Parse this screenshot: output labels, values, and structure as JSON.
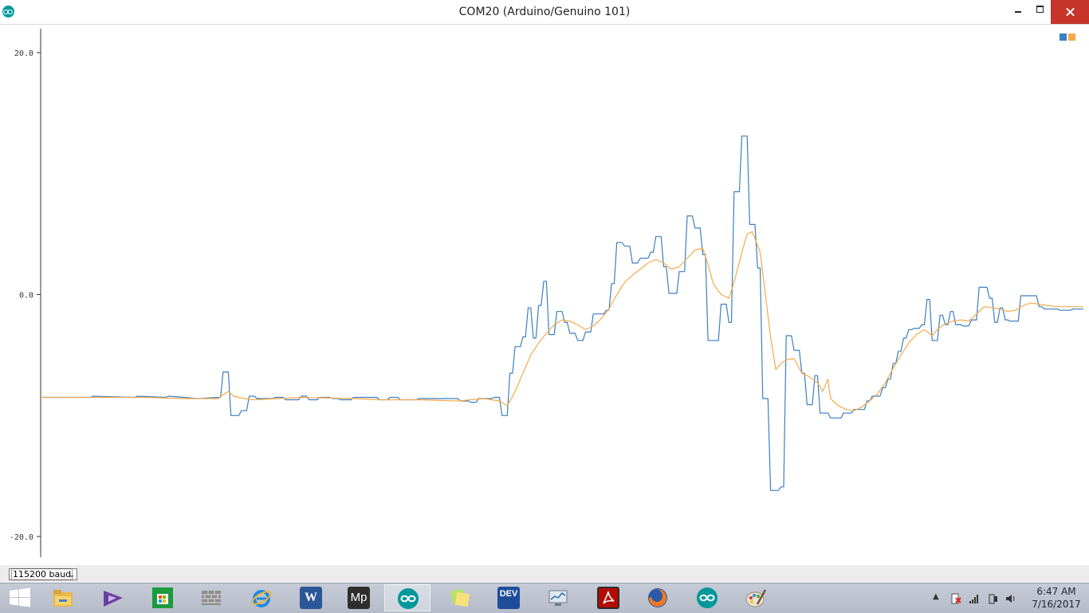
{
  "window": {
    "title": "COM20 (Arduino/Genuino 101)",
    "controls": [
      "minimize",
      "maximize",
      "close"
    ]
  },
  "legend": {
    "colors": [
      "#3a7fc1",
      "#f7a94a"
    ]
  },
  "bottom_bar": {
    "baud_rate": "115200 baud"
  },
  "taskbar": {
    "items": [
      {
        "name": "start",
        "icon": "windows-logo-icon"
      },
      {
        "name": "file-explorer",
        "icon": "folder-icon"
      },
      {
        "name": "visual-studio",
        "icon": "visual-studio-icon"
      },
      {
        "name": "store",
        "icon": "store-icon"
      },
      {
        "name": "firewall",
        "icon": "brick-wall-icon"
      },
      {
        "name": "internet-explorer",
        "icon": "internet-explorer-icon"
      },
      {
        "name": "word",
        "icon": "word-icon"
      },
      {
        "name": "mplab",
        "icon": "mplab-icon"
      },
      {
        "name": "arduino",
        "icon": "arduino-icon"
      },
      {
        "name": "sticky-notes",
        "icon": "sticky-notes-icon"
      },
      {
        "name": "dev-cpp",
        "icon": "dev-icon"
      },
      {
        "name": "monitor",
        "icon": "monitor-icon"
      },
      {
        "name": "acrobat",
        "icon": "acrobat-icon"
      },
      {
        "name": "firefox",
        "icon": "firefox-icon"
      },
      {
        "name": "arduino-2",
        "icon": "arduino-icon"
      },
      {
        "name": "paint",
        "icon": "paint-icon"
      }
    ],
    "dev_label": "DEV",
    "mp_label": "Mp",
    "word_label": "W",
    "tray": {
      "time": "6:47 AM",
      "date": "7/16/2017",
      "icons": [
        "show-hidden-icon",
        "action-center-icon",
        "network-icon",
        "power-icon",
        "volume-icon"
      ]
    }
  },
  "chart_data": {
    "type": "line",
    "ylim": [
      -20.0,
      20.0
    ],
    "yticks": [
      "20.0",
      "0.0",
      "-20.0"
    ],
    "ytick_values": [
      20,
      0,
      -20
    ],
    "n_samples": 500,
    "series": [
      {
        "color": "#3a7fc1",
        "style": "step",
        "points": [
          [
            0,
            -8.5
          ],
          [
            19,
            -8.5
          ],
          [
            20,
            -8.4
          ],
          [
            36,
            -8.5
          ],
          [
            37,
            -8.4
          ],
          [
            48,
            -8.5
          ],
          [
            49,
            -8.4
          ],
          [
            55,
            -8.5
          ],
          [
            60,
            -8.6
          ],
          [
            68,
            -8.5
          ],
          [
            69,
            -8.5
          ],
          [
            70,
            -6.4
          ],
          [
            72,
            -6.4
          ],
          [
            73,
            -10.0
          ],
          [
            76,
            -10.0
          ],
          [
            77,
            -9.6
          ],
          [
            79,
            -9.6
          ],
          [
            80,
            -8.4
          ],
          [
            82,
            -8.4
          ],
          [
            83,
            -8.6
          ],
          [
            89,
            -8.6
          ],
          [
            90,
            -8.5
          ],
          [
            93,
            -8.5
          ],
          [
            94,
            -8.7
          ],
          [
            99,
            -8.7
          ],
          [
            100,
            -8.4
          ],
          [
            102,
            -8.4
          ],
          [
            103,
            -8.7
          ],
          [
            106,
            -8.7
          ],
          [
            107,
            -8.5
          ],
          [
            111,
            -8.5
          ],
          [
            112,
            -8.6
          ],
          [
            114,
            -8.6
          ],
          [
            115,
            -8.7
          ],
          [
            119,
            -8.7
          ],
          [
            120,
            -8.5
          ],
          [
            129,
            -8.5
          ],
          [
            130,
            -8.7
          ],
          [
            133,
            -8.7
          ],
          [
            134,
            -8.5
          ],
          [
            137,
            -8.5
          ],
          [
            138,
            -8.7
          ],
          [
            144,
            -8.7
          ],
          [
            145,
            -8.6
          ],
          [
            160,
            -8.6
          ],
          [
            161,
            -8.8
          ],
          [
            164,
            -8.8
          ],
          [
            165,
            -8.9
          ],
          [
            167,
            -8.9
          ],
          [
            168,
            -8.6
          ],
          [
            173,
            -8.6
          ],
          [
            174,
            -8.5
          ],
          [
            176,
            -8.5
          ],
          [
            177,
            -10.0
          ],
          [
            179,
            -10.0
          ],
          [
            180,
            -6.5
          ],
          [
            181,
            -6.5
          ],
          [
            182,
            -4.3
          ],
          [
            184,
            -4.3
          ],
          [
            185,
            -3.5
          ],
          [
            186,
            -3.5
          ],
          [
            187,
            -1.1
          ],
          [
            188,
            -1.1
          ],
          [
            189,
            -3.6
          ],
          [
            190,
            -3.6
          ],
          [
            191,
            -0.9
          ],
          [
            192,
            -0.9
          ],
          [
            193,
            1.1
          ],
          [
            194,
            1.1
          ],
          [
            195,
            -3.3
          ],
          [
            197,
            -3.3
          ],
          [
            198,
            -1.4
          ],
          [
            200,
            -1.4
          ],
          [
            201,
            -2.3
          ],
          [
            202,
            -2.3
          ],
          [
            203,
            -3.2
          ],
          [
            205,
            -3.2
          ],
          [
            206,
            -3.8
          ],
          [
            208,
            -3.8
          ],
          [
            209,
            -3.1
          ],
          [
            211,
            -3.1
          ],
          [
            212,
            -1.6
          ],
          [
            216,
            -1.6
          ],
          [
            217,
            -1.3
          ],
          [
            218,
            -1.3
          ],
          [
            219,
            0.9
          ],
          [
            220,
            0.9
          ],
          [
            221,
            4.3
          ],
          [
            223,
            4.3
          ],
          [
            224,
            4.0
          ],
          [
            226,
            4.0
          ],
          [
            227,
            2.6
          ],
          [
            229,
            2.6
          ],
          [
            230,
            3.0
          ],
          [
            233,
            3.0
          ],
          [
            234,
            3.5
          ],
          [
            235,
            3.5
          ],
          [
            236,
            4.8
          ],
          [
            238,
            4.8
          ],
          [
            239,
            2.3
          ],
          [
            240,
            2.3
          ],
          [
            241,
            0.1
          ],
          [
            244,
            0.1
          ],
          [
            245,
            1.9
          ],
          [
            247,
            1.9
          ],
          [
            248,
            6.5
          ],
          [
            250,
            6.5
          ],
          [
            251,
            5.5
          ],
          [
            253,
            5.5
          ],
          [
            254,
            3.3
          ],
          [
            255,
            3.3
          ],
          [
            256,
            -3.8
          ],
          [
            260,
            -3.8
          ],
          [
            261,
            -0.8
          ],
          [
            263,
            -0.8
          ],
          [
            264,
            -2.3
          ],
          [
            265,
            -2.3
          ],
          [
            266,
            8.5
          ],
          [
            268,
            8.5
          ],
          [
            269,
            13.1
          ],
          [
            271,
            13.1
          ],
          [
            272,
            5.8
          ],
          [
            274,
            5.8
          ],
          [
            275,
            2.2
          ],
          [
            276,
            2.2
          ],
          [
            277,
            -8.6
          ],
          [
            279,
            -8.6
          ],
          [
            280,
            -16.2
          ],
          [
            283,
            -16.2
          ],
          [
            284,
            -15.9
          ],
          [
            285,
            -15.9
          ],
          [
            286,
            -3.4
          ],
          [
            288,
            -3.4
          ],
          [
            289,
            -4.6
          ],
          [
            291,
            -4.6
          ],
          [
            292,
            -6.5
          ],
          [
            293,
            -6.5
          ],
          [
            294,
            -9.1
          ],
          [
            296,
            -9.1
          ],
          [
            297,
            -6.7
          ],
          [
            298,
            -6.7
          ],
          [
            299,
            -9.8
          ],
          [
            302,
            -9.8
          ],
          [
            303,
            -10.2
          ],
          [
            307,
            -10.2
          ],
          [
            308,
            -9.8
          ],
          [
            311,
            -9.8
          ],
          [
            312,
            -9.5
          ],
          [
            316,
            -9.5
          ],
          [
            317,
            -8.8
          ],
          [
            318,
            -8.8
          ],
          [
            319,
            -8.4
          ],
          [
            322,
            -8.4
          ],
          [
            323,
            -7.7
          ],
          [
            324,
            -7.7
          ],
          [
            325,
            -7.0
          ],
          [
            326,
            -7.0
          ],
          [
            327,
            -5.7
          ],
          [
            328,
            -5.7
          ],
          [
            329,
            -4.7
          ],
          [
            330,
            -4.7
          ],
          [
            331,
            -3.6
          ],
          [
            332,
            -3.6
          ],
          [
            333,
            -2.9
          ],
          [
            334,
            -2.9
          ],
          [
            335,
            -2.8
          ],
          [
            337,
            -2.8
          ],
          [
            338,
            -2.5
          ],
          [
            339,
            -2.5
          ],
          [
            340,
            -0.4
          ],
          [
            341,
            -0.4
          ],
          [
            342,
            -3.8
          ],
          [
            344,
            -3.8
          ],
          [
            345,
            -1.7
          ],
          [
            346,
            -1.7
          ],
          [
            347,
            -2.5
          ],
          [
            348,
            -2.5
          ],
          [
            349,
            -1.4
          ],
          [
            350,
            -1.4
          ],
          [
            351,
            -2.5
          ],
          [
            353,
            -2.5
          ],
          [
            354,
            -2.6
          ],
          [
            356,
            -2.6
          ],
          [
            357,
            -2.1
          ],
          [
            359,
            -2.1
          ],
          [
            360,
            0.6
          ],
          [
            363,
            0.6
          ],
          [
            364,
            -0.3
          ],
          [
            365,
            -0.3
          ],
          [
            366,
            -2.3
          ],
          [
            367,
            -2.3
          ],
          [
            368,
            -1.1
          ],
          [
            369,
            -1.1
          ],
          [
            370,
            -2.1
          ],
          [
            371,
            -2.1
          ],
          [
            372,
            -2.2
          ],
          [
            375,
            -2.2
          ],
          [
            376,
            -0.1
          ],
          [
            382,
            -0.1
          ],
          [
            383,
            -1.0
          ],
          [
            384,
            -1.0
          ],
          [
            385,
            -1.2
          ],
          [
            390,
            -1.2
          ],
          [
            391,
            -1.3
          ],
          [
            395,
            -1.3
          ],
          [
            396,
            -1.2
          ],
          [
            400,
            -1.2
          ]
        ]
      },
      {
        "color": "#f7a94a",
        "style": "line",
        "points": [
          [
            0,
            -8.5
          ],
          [
            20,
            -8.5
          ],
          [
            40,
            -8.5
          ],
          [
            55,
            -8.6
          ],
          [
            68,
            -8.6
          ],
          [
            72,
            -8.0
          ],
          [
            74,
            -8.4
          ],
          [
            78,
            -8.6
          ],
          [
            82,
            -8.7
          ],
          [
            100,
            -8.5
          ],
          [
            120,
            -8.6
          ],
          [
            130,
            -8.7
          ],
          [
            145,
            -8.7
          ],
          [
            160,
            -8.8
          ],
          [
            170,
            -8.6
          ],
          [
            176,
            -8.8
          ],
          [
            179,
            -9.2
          ],
          [
            182,
            -8.0
          ],
          [
            185,
            -6.5
          ],
          [
            188,
            -5.0
          ],
          [
            191,
            -4.0
          ],
          [
            194,
            -3.2
          ],
          [
            197,
            -2.5
          ],
          [
            200,
            -2.1
          ],
          [
            203,
            -2.2
          ],
          [
            206,
            -2.5
          ],
          [
            209,
            -2.9
          ],
          [
            212,
            -2.6
          ],
          [
            215,
            -2.0
          ],
          [
            218,
            -1.2
          ],
          [
            221,
            0.0
          ],
          [
            224,
            1.0
          ],
          [
            227,
            1.6
          ],
          [
            230,
            2.1
          ],
          [
            233,
            2.6
          ],
          [
            236,
            2.9
          ],
          [
            239,
            2.6
          ],
          [
            242,
            2.1
          ],
          [
            245,
            2.3
          ],
          [
            248,
            3.0
          ],
          [
            251,
            3.7
          ],
          [
            254,
            3.8
          ],
          [
            256,
            2.5
          ],
          [
            258,
            0.9
          ],
          [
            261,
            0.0
          ],
          [
            264,
            -0.3
          ],
          [
            266,
            1.0
          ],
          [
            269,
            3.5
          ],
          [
            271,
            5.0
          ],
          [
            273,
            5.2
          ],
          [
            276,
            3.5
          ],
          [
            278,
            0.0
          ],
          [
            280,
            -3.5
          ],
          [
            282,
            -6.2
          ],
          [
            284,
            -5.7
          ],
          [
            286,
            -5.4
          ],
          [
            289,
            -5.3
          ],
          [
            292,
            -6.5
          ],
          [
            295,
            -6.8
          ],
          [
            298,
            -7.3
          ],
          [
            300,
            -8.0
          ],
          [
            302,
            -7.0
          ],
          [
            303,
            -8.6
          ],
          [
            306,
            -9.2
          ],
          [
            309,
            -9.5
          ],
          [
            312,
            -9.6
          ],
          [
            315,
            -9.3
          ],
          [
            318,
            -8.8
          ],
          [
            321,
            -8.2
          ],
          [
            324,
            -7.3
          ],
          [
            327,
            -6.1
          ],
          [
            330,
            -5.0
          ],
          [
            333,
            -4.0
          ],
          [
            336,
            -3.3
          ],
          [
            339,
            -2.9
          ],
          [
            342,
            -3.4
          ],
          [
            344,
            -2.9
          ],
          [
            347,
            -2.4
          ],
          [
            350,
            -2.2
          ],
          [
            353,
            -2.1
          ],
          [
            356,
            -2.2
          ],
          [
            359,
            -1.6
          ],
          [
            362,
            -1.0
          ],
          [
            365,
            -1.1
          ],
          [
            368,
            -1.2
          ],
          [
            371,
            -1.4
          ],
          [
            374,
            -1.3
          ],
          [
            377,
            -0.9
          ],
          [
            380,
            -0.7
          ],
          [
            383,
            -0.8
          ],
          [
            386,
            -0.9
          ],
          [
            390,
            -1.0
          ],
          [
            395,
            -1.0
          ],
          [
            400,
            -1.0
          ]
        ]
      }
    ]
  }
}
